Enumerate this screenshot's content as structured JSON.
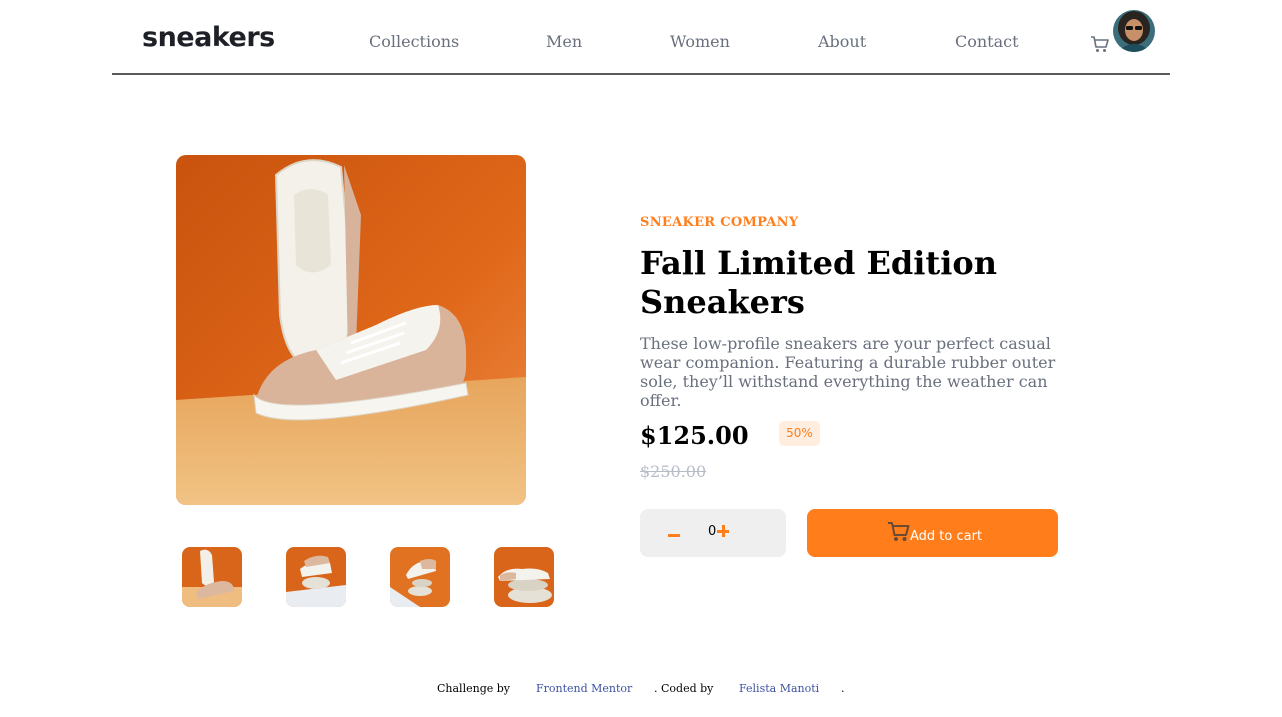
{
  "header": {
    "logo": "sneakers",
    "nav": [
      "Collections",
      "Men",
      "Women",
      "About",
      "Contact"
    ],
    "cart_icon": "cart-icon",
    "avatar_icon": "user-avatar"
  },
  "product": {
    "company": "SNEAKER COMPANY",
    "title": "Fall Limited Edition Sneakers",
    "description": "These low-profile sneakers are your perfect casual wear companion. Featuring a durable rubber outer sole, they’ll withstand everything the weather can offer.",
    "price": "$125.00",
    "discount": "50%",
    "old_price": "$250.00",
    "quantity": "0",
    "add_to_cart": "Add to cart",
    "thumbnails": 4
  },
  "footer": {
    "challenge_text": "Challenge by",
    "challenge_link": "Frontend Mentor",
    "coded_text": ". Coded by",
    "author_link": "Felista Manoti",
    "end_text": "."
  },
  "colors": {
    "accent": "#ff7e1b",
    "accent_pale": "#ffede0",
    "text_gray": "#69707d",
    "strike_gray": "#b6bcc8",
    "link_blue": "#3e52a3"
  }
}
